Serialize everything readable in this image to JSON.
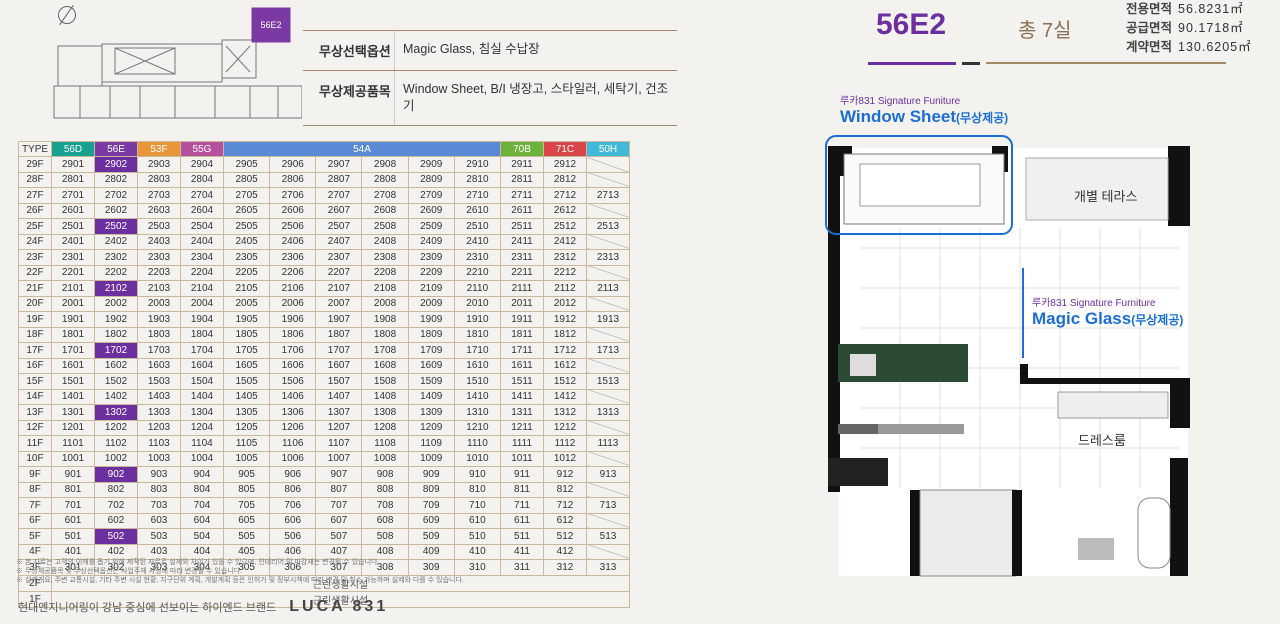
{
  "keyplan": {
    "unit_label": "56E2"
  },
  "options": [
    {
      "key": "무상선택옵션",
      "value": "Magic Glass, 침실 수납장"
    },
    {
      "key": "무상제공품목",
      "value": "Window Sheet, B/I 냉장고, 스타일러, 세탁기, 건조기"
    }
  ],
  "table": {
    "header": [
      "TYPE",
      "56D",
      "56E",
      "53F",
      "55G",
      "54A",
      "70B",
      "71C",
      "50H"
    ],
    "rows": [
      {
        "f": "29F",
        "u": [
          "2901",
          "2902",
          "2903",
          "2904",
          "2905",
          "2906",
          "2907",
          "2908",
          "2909",
          "2910",
          "2911",
          "2912",
          ""
        ],
        "hl": true
      },
      {
        "f": "28F",
        "u": [
          "2801",
          "2802",
          "2803",
          "2804",
          "2805",
          "2806",
          "2807",
          "2808",
          "2809",
          "2810",
          "2811",
          "2812",
          ""
        ]
      },
      {
        "f": "27F",
        "u": [
          "2701",
          "2702",
          "2703",
          "2704",
          "2705",
          "2706",
          "2707",
          "2708",
          "2709",
          "2710",
          "2711",
          "2712",
          "2713"
        ]
      },
      {
        "f": "26F",
        "u": [
          "2601",
          "2602",
          "2603",
          "2604",
          "2605",
          "2606",
          "2607",
          "2608",
          "2609",
          "2610",
          "2611",
          "2612",
          ""
        ]
      },
      {
        "f": "25F",
        "u": [
          "2501",
          "2502",
          "2503",
          "2504",
          "2505",
          "2506",
          "2507",
          "2508",
          "2509",
          "2510",
          "2511",
          "2512",
          "2513"
        ],
        "hl": true
      },
      {
        "f": "24F",
        "u": [
          "2401",
          "2402",
          "2403",
          "2404",
          "2405",
          "2406",
          "2407",
          "2408",
          "2409",
          "2410",
          "2411",
          "2412",
          ""
        ]
      },
      {
        "f": "23F",
        "u": [
          "2301",
          "2302",
          "2303",
          "2304",
          "2305",
          "2306",
          "2307",
          "2308",
          "2309",
          "2310",
          "2311",
          "2312",
          "2313"
        ]
      },
      {
        "f": "22F",
        "u": [
          "2201",
          "2202",
          "2203",
          "2204",
          "2205",
          "2206",
          "2207",
          "2208",
          "2209",
          "2210",
          "2211",
          "2212",
          ""
        ]
      },
      {
        "f": "21F",
        "u": [
          "2101",
          "2102",
          "2103",
          "2104",
          "2105",
          "2106",
          "2107",
          "2108",
          "2109",
          "2110",
          "2111",
          "2112",
          "2113"
        ],
        "hl": true
      },
      {
        "f": "20F",
        "u": [
          "2001",
          "2002",
          "2003",
          "2004",
          "2005",
          "2006",
          "2007",
          "2008",
          "2009",
          "2010",
          "2011",
          "2012",
          ""
        ]
      },
      {
        "f": "19F",
        "u": [
          "1901",
          "1902",
          "1903",
          "1904",
          "1905",
          "1906",
          "1907",
          "1908",
          "1909",
          "1910",
          "1911",
          "1912",
          "1913"
        ]
      },
      {
        "f": "18F",
        "u": [
          "1801",
          "1802",
          "1803",
          "1804",
          "1805",
          "1806",
          "1807",
          "1808",
          "1809",
          "1810",
          "1811",
          "1812",
          ""
        ]
      },
      {
        "f": "17F",
        "u": [
          "1701",
          "1702",
          "1703",
          "1704",
          "1705",
          "1706",
          "1707",
          "1708",
          "1709",
          "1710",
          "1711",
          "1712",
          "1713"
        ],
        "hl": true
      },
      {
        "f": "16F",
        "u": [
          "1601",
          "1602",
          "1603",
          "1604",
          "1605",
          "1606",
          "1607",
          "1608",
          "1609",
          "1610",
          "1611",
          "1612",
          ""
        ]
      },
      {
        "f": "15F",
        "u": [
          "1501",
          "1502",
          "1503",
          "1504",
          "1505",
          "1506",
          "1507",
          "1508",
          "1509",
          "1510",
          "1511",
          "1512",
          "1513"
        ]
      },
      {
        "f": "14F",
        "u": [
          "1401",
          "1402",
          "1403",
          "1404",
          "1405",
          "1406",
          "1407",
          "1408",
          "1409",
          "1410",
          "1411",
          "1412",
          ""
        ]
      },
      {
        "f": "13F",
        "u": [
          "1301",
          "1302",
          "1303",
          "1304",
          "1305",
          "1306",
          "1307",
          "1308",
          "1309",
          "1310",
          "1311",
          "1312",
          "1313"
        ],
        "hl": true
      },
      {
        "f": "12F",
        "u": [
          "1201",
          "1202",
          "1203",
          "1204",
          "1205",
          "1206",
          "1207",
          "1208",
          "1209",
          "1210",
          "1211",
          "1212",
          ""
        ]
      },
      {
        "f": "11F",
        "u": [
          "1101",
          "1102",
          "1103",
          "1104",
          "1105",
          "1106",
          "1107",
          "1108",
          "1109",
          "1110",
          "1111",
          "1112",
          "1113"
        ]
      },
      {
        "f": "10F",
        "u": [
          "1001",
          "1002",
          "1003",
          "1004",
          "1005",
          "1006",
          "1007",
          "1008",
          "1009",
          "1010",
          "1011",
          "1012",
          ""
        ]
      },
      {
        "f": "9F",
        "u": [
          "901",
          "902",
          "903",
          "904",
          "905",
          "906",
          "907",
          "908",
          "909",
          "910",
          "911",
          "912",
          "913"
        ],
        "hl": true
      },
      {
        "f": "8F",
        "u": [
          "801",
          "802",
          "803",
          "804",
          "805",
          "806",
          "807",
          "808",
          "809",
          "810",
          "811",
          "812",
          ""
        ]
      },
      {
        "f": "7F",
        "u": [
          "701",
          "702",
          "703",
          "704",
          "705",
          "706",
          "707",
          "708",
          "709",
          "710",
          "711",
          "712",
          "713"
        ]
      },
      {
        "f": "6F",
        "u": [
          "601",
          "602",
          "603",
          "604",
          "605",
          "606",
          "607",
          "608",
          "609",
          "610",
          "611",
          "612",
          ""
        ]
      },
      {
        "f": "5F",
        "u": [
          "501",
          "502",
          "503",
          "504",
          "505",
          "506",
          "507",
          "508",
          "509",
          "510",
          "511",
          "512",
          "513"
        ],
        "hl": true
      },
      {
        "f": "4F",
        "u": [
          "401",
          "402",
          "403",
          "404",
          "405",
          "406",
          "407",
          "408",
          "409",
          "410",
          "411",
          "412",
          ""
        ]
      },
      {
        "f": "3F",
        "u": [
          "301",
          "302",
          "303",
          "304",
          "305",
          "306",
          "307",
          "308",
          "309",
          "310",
          "311",
          "312",
          "313"
        ]
      }
    ],
    "merged_rows": [
      {
        "f": "2F",
        "text": "근린생활시설"
      },
      {
        "f": "1F",
        "text": "근린생활시설"
      }
    ]
  },
  "notes": [
    "※ 본 자료는 고객의 이해를 돕기 위해 제작된 자료로 실제와 차이가 있을 수 있으며, 인테리어 및 마감재는 변경될 수 있습니다.",
    "※ 무상제공품목 및 무상선택옵션은 사업주체 사정에 따라 변경될 수 있습니다.",
    "※ 설계개요, 주변 교통시설, 기타 주변 시설 현황, 지구단위 계획, 개발계획 등은 인허가 및 정부시책에 따라 변경 및 취소 가능하며 실제와 다를 수 있습니다."
  ],
  "footer": {
    "tagline": "현대엔지니어링이 강남 중심에 선보이는 하이엔드 브랜드",
    "brand": "LUCA 831"
  },
  "unit": {
    "code": "56E2",
    "total": "총 7실",
    "areas": [
      {
        "label": "전용면적",
        "value": "56.8231㎡"
      },
      {
        "label": "공급면적",
        "value": "90.1718㎡"
      },
      {
        "label": "계약면적",
        "value": "130.6205㎡"
      }
    ]
  },
  "callouts": {
    "window_sheet": {
      "sub": "루카831 Signature Funiture",
      "title": "Window Sheet",
      "tag": "(무상제공)"
    },
    "magic_glass": {
      "sub": "루카831 Signature Furniture",
      "title": "Magic Glass",
      "tag": "(무상제공)"
    }
  },
  "plan_labels": {
    "terrace": "개별 테라스",
    "dressroom": "드레스룸"
  }
}
